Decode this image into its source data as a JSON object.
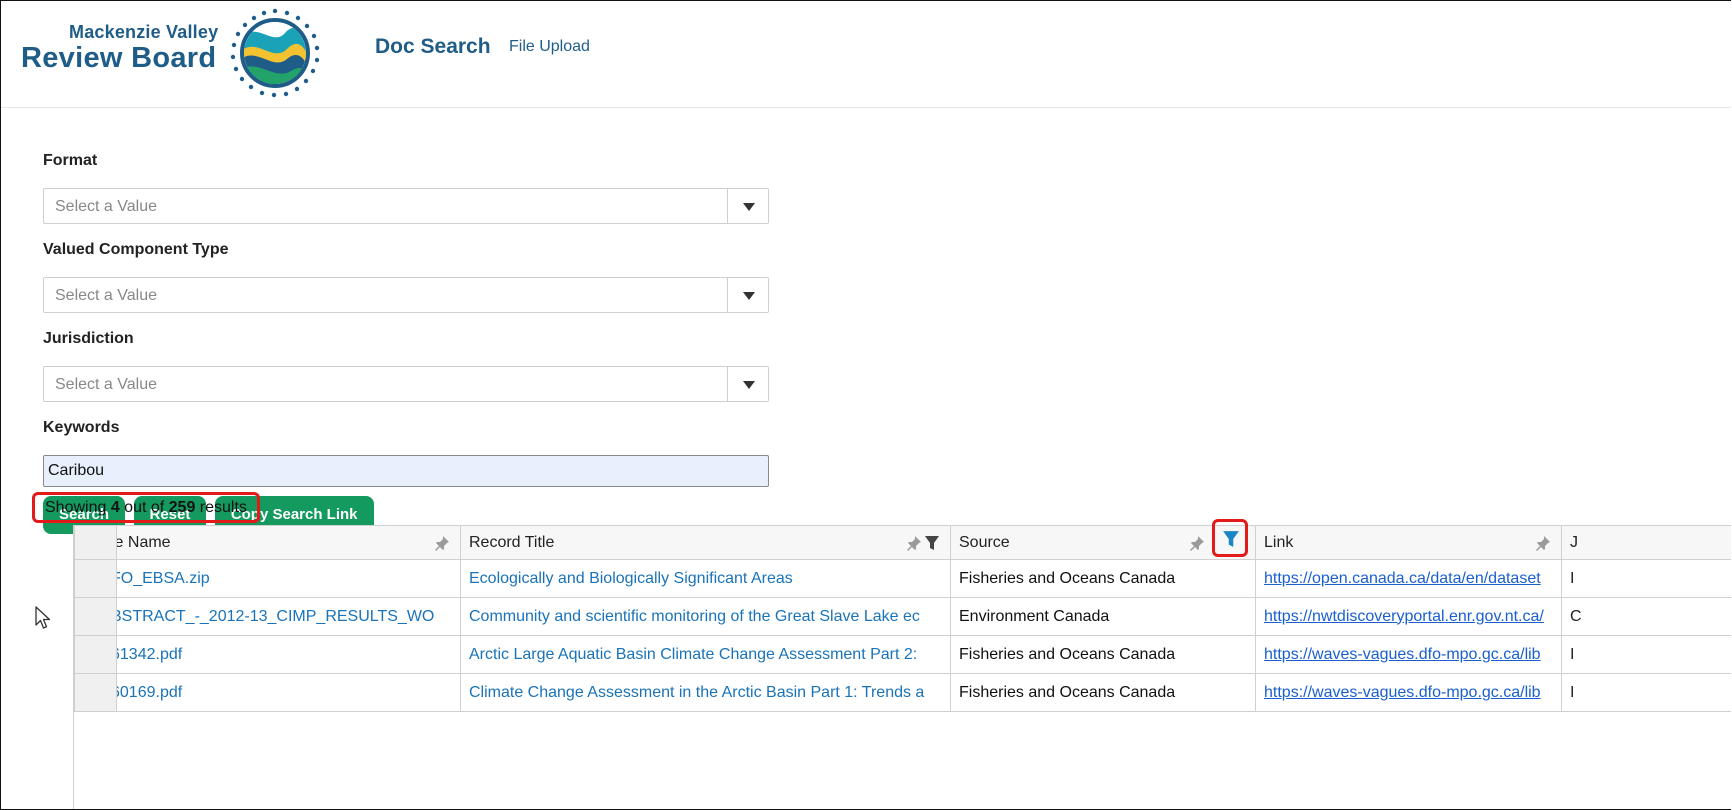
{
  "header": {
    "logo_line1": "Mackenzie Valley",
    "logo_line2": "Review Board",
    "nav_primary": "Doc Search",
    "nav_secondary": "File Upload"
  },
  "form": {
    "format": {
      "label": "Format",
      "placeholder": "Select a Value"
    },
    "vc_type": {
      "label": "Valued Component Type",
      "placeholder": "Select a Value"
    },
    "jurisdiction": {
      "label": "Jurisdiction",
      "placeholder": "Select a Value"
    },
    "keywords": {
      "label": "Keywords",
      "value": "Caribou"
    },
    "buttons": {
      "search": "Search",
      "reset": "Reset",
      "copy_link": "Copy Search Link"
    }
  },
  "results": {
    "prefix": "Showing ",
    "shown": "4",
    "middle": " out of ",
    "total": "259",
    "suffix": " results"
  },
  "table": {
    "headers": {
      "file_name": "le Name",
      "record_title": "Record Title",
      "source": "Source",
      "link": "Link",
      "extra": "J"
    },
    "rows": [
      {
        "file_name": "FO_EBSA.zip",
        "record_title": "Ecologically and Biologically Significant Areas",
        "source": "Fisheries and Oceans Canada",
        "link": "https://open.canada.ca/data/en/dataset",
        "extra": "I"
      },
      {
        "file_name": "BSTRACT_-_2012-13_CIMP_RESULTS_WO",
        "record_title": "Community and scientific monitoring of the Great Slave Lake ec",
        "source": "Environment Canada",
        "link": "https://nwtdiscoveryportal.enr.gov.nt.ca/",
        "extra": "C"
      },
      {
        "file_name": "61342.pdf",
        "record_title": "Arctic Large Aquatic Basin Climate Change Assessment Part 2:",
        "source": "Fisheries and Oceans Canada",
        "link": "https://waves-vagues.dfo-mpo.gc.ca/lib",
        "extra": "I"
      },
      {
        "file_name": "60169.pdf",
        "record_title": "Climate Change Assessment in the Arctic Basin Part 1: Trends a",
        "source": "Fisheries and Oceans Canada",
        "link": "https://waves-vagues.dfo-mpo.gc.ca/lib",
        "extra": "I"
      }
    ]
  },
  "colors": {
    "brand_blue": "#1f5d88",
    "button_green": "#14995f",
    "highlight_red": "#e21a1a",
    "link_blue": "#1a73b8",
    "filter_active": "#1a86c8"
  },
  "icons": {
    "pin": "pin-icon",
    "filter": "filter-icon",
    "cursor": "mouse-cursor-icon"
  }
}
